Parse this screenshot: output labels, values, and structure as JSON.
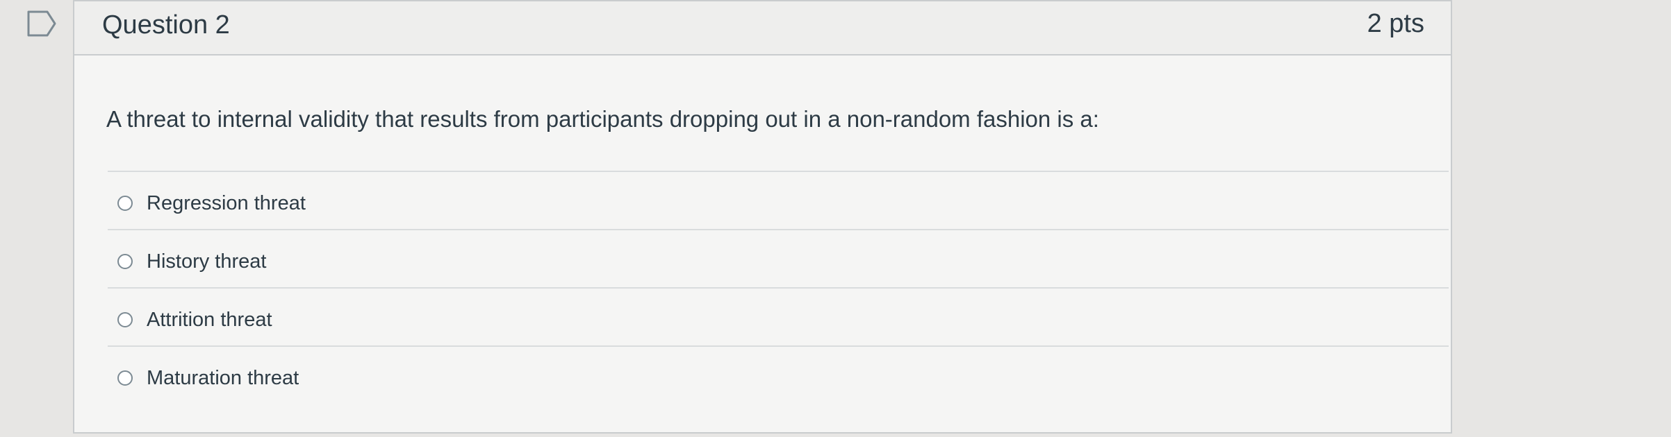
{
  "question": {
    "title": "Question 2",
    "points": "2 pts",
    "text": "A threat to internal validity that results from participants dropping out in a non-random fashion is a:"
  },
  "answers": [
    {
      "label": "Regression threat",
      "selected": false
    },
    {
      "label": "History threat",
      "selected": false
    },
    {
      "label": "Attrition threat",
      "selected": false
    },
    {
      "label": "Maturation threat",
      "selected": false
    }
  ],
  "icons": {
    "flag": "flag-question-icon"
  },
  "colors": {
    "page_background": "#e7e6e4",
    "card_background": "#f5f5f4",
    "header_background": "#eeeeed",
    "text": "#2d3b45",
    "border": "#c9ccce"
  }
}
